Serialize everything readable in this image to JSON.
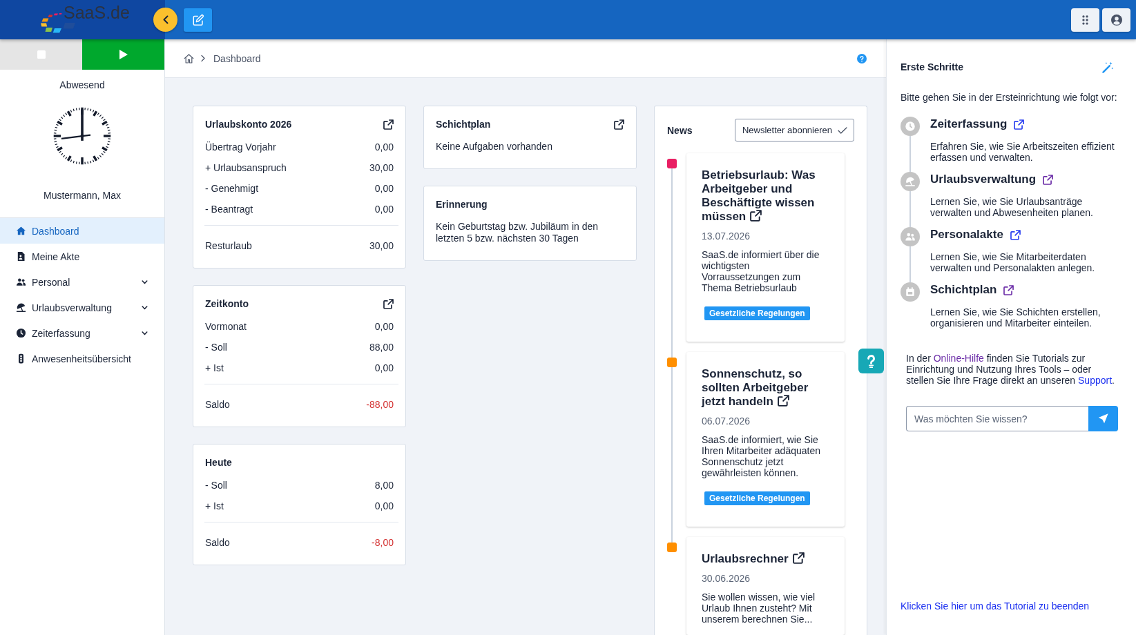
{
  "header": {
    "logo": "SaaS.de"
  },
  "sidebar": {
    "clock_buttons": [
      {
        "kind": "stop",
        "enabled": false
      },
      {
        "kind": "play",
        "enabled": true
      }
    ],
    "status": "Abwesend",
    "user": "Mustermann, Max",
    "items": [
      {
        "label": "Dashboard",
        "selected": true,
        "has_submenu": false
      },
      {
        "label": "Meine Akte",
        "selected": false,
        "has_submenu": false
      },
      {
        "label": "Personal",
        "selected": false,
        "has_submenu": true
      },
      {
        "label": "Urlaubsverwaltung",
        "selected": false,
        "has_submenu": true
      },
      {
        "label": "Zeiterfassung",
        "selected": false,
        "has_submenu": true
      },
      {
        "label": "Anwesenheitsübersicht",
        "selected": false,
        "has_submenu": false
      }
    ]
  },
  "breadcrumb": [
    "Dashboard"
  ],
  "account_cards": [
    {
      "title": "Urlaubskonto 2026",
      "has_link": true,
      "rows": [
        {
          "label": "Übertrag Vorjahr",
          "value": "0,00"
        },
        {
          "label": "+ Urlaubsanspruch",
          "value": "30,00"
        },
        {
          "label": "- Genehmigt",
          "value": "0,00"
        },
        {
          "label": "- Beantragt",
          "value": "0,00"
        }
      ],
      "total": {
        "label": "Resturlaub",
        "value": "30,00",
        "negative": false
      }
    },
    {
      "title": "Zeitkonto",
      "has_link": true,
      "rows": [
        {
          "label": "Vormonat",
          "value": "0,00"
        },
        {
          "label": "- Soll",
          "value": "88,00"
        },
        {
          "label": "+ Ist",
          "value": "0,00"
        }
      ],
      "total": {
        "label": "Saldo",
        "value": "-88,00",
        "negative": true
      }
    },
    {
      "title": "Heute",
      "has_link": false,
      "rows": [
        {
          "label": "- Soll",
          "value": "8,00"
        },
        {
          "label": "+ Ist",
          "value": "0,00"
        }
      ],
      "total": {
        "label": "Saldo",
        "value": "-8,00",
        "negative": true
      }
    }
  ],
  "info_cards": [
    {
      "title": "Schichtplan",
      "has_link": true,
      "text": "Keine Aufgaben vorhanden"
    },
    {
      "title": "Erinnerung",
      "has_link": false,
      "text": "Kein Geburtstag bzw. Jubiläum in den letzten 5 bzw. nächsten 30 Tagen"
    }
  ],
  "news": {
    "title": "News",
    "subscribe_button": "Newsletter abonnieren",
    "items": [
      {
        "title": "Betriebsurlaub: Was Arbeitgeber und Beschäftigte wissen müssen",
        "date": "13.07.2026",
        "text": "SaaS.de informiert über die wichtigsten Vorraussetzungen zum Thema Betriebsurlaub",
        "tag": "Gesetzliche Regelungen",
        "color": "#e91e63"
      },
      {
        "title": "Sonnenschutz, so sollten Arbeitgeber jetzt handeln",
        "date": "06.07.2026",
        "text": "SaaS.de informiert, wie Sie Ihren Mitarbeiter adäquaten Sonnenschutz jetzt gewährleisten können.",
        "tag": "Gesetzliche Regelungen",
        "color": "#ff8f00"
      },
      {
        "title": "Urlaubsrechner",
        "date": "30.06.2026",
        "text": "Sie wollen wissen, wie viel Urlaub Ihnen zusteht? Mit unserem berechnen Sie...",
        "color": "#ff8f00"
      }
    ]
  },
  "guide": {
    "title": "Erste Schritte",
    "intro": "Bitte gehen Sie in der Ersteinrichtung wie folgt vor:",
    "steps": [
      {
        "title": "Zeiterfassung",
        "text": "Erfahren Sie, wie Sie Arbeitszeiten effizient erfassen und verwalten.",
        "visited": false
      },
      {
        "title": "Urlaubsverwaltung",
        "text": "Lernen Sie, wie Sie Urlaubsanträge verwalten und Abwesenheiten planen.",
        "visited": true
      },
      {
        "title": "Personalakte",
        "text": "Lernen Sie, wie Sie Mitarbeiterdaten verwalten und Personalakten anlegen.",
        "visited": false
      },
      {
        "title": "Schichtplan",
        "text": "Lernen Sie, wie Sie Schichten erstellen, organisieren und Mitarbeiter einteilen.",
        "visited": true
      }
    ],
    "help_text": [
      {
        "kind": "text",
        "text": "In der "
      },
      {
        "kind": "link",
        "text": "Online-Hilfe",
        "visited": true
      },
      {
        "kind": "text",
        "text": " finden Sie Tutorials zur Einrichtung und Nutzung Ihres Tools – oder stellen Sie Ihre Frage direkt an unseren "
      },
      {
        "kind": "link",
        "text": "Support",
        "visited": false
      },
      {
        "kind": "text",
        "text": "."
      }
    ],
    "question": {
      "placeholder": "Was möchten Sie wissen?"
    },
    "end_link": "Klicken Sie hier um das Tutorial zu beenden"
  }
}
